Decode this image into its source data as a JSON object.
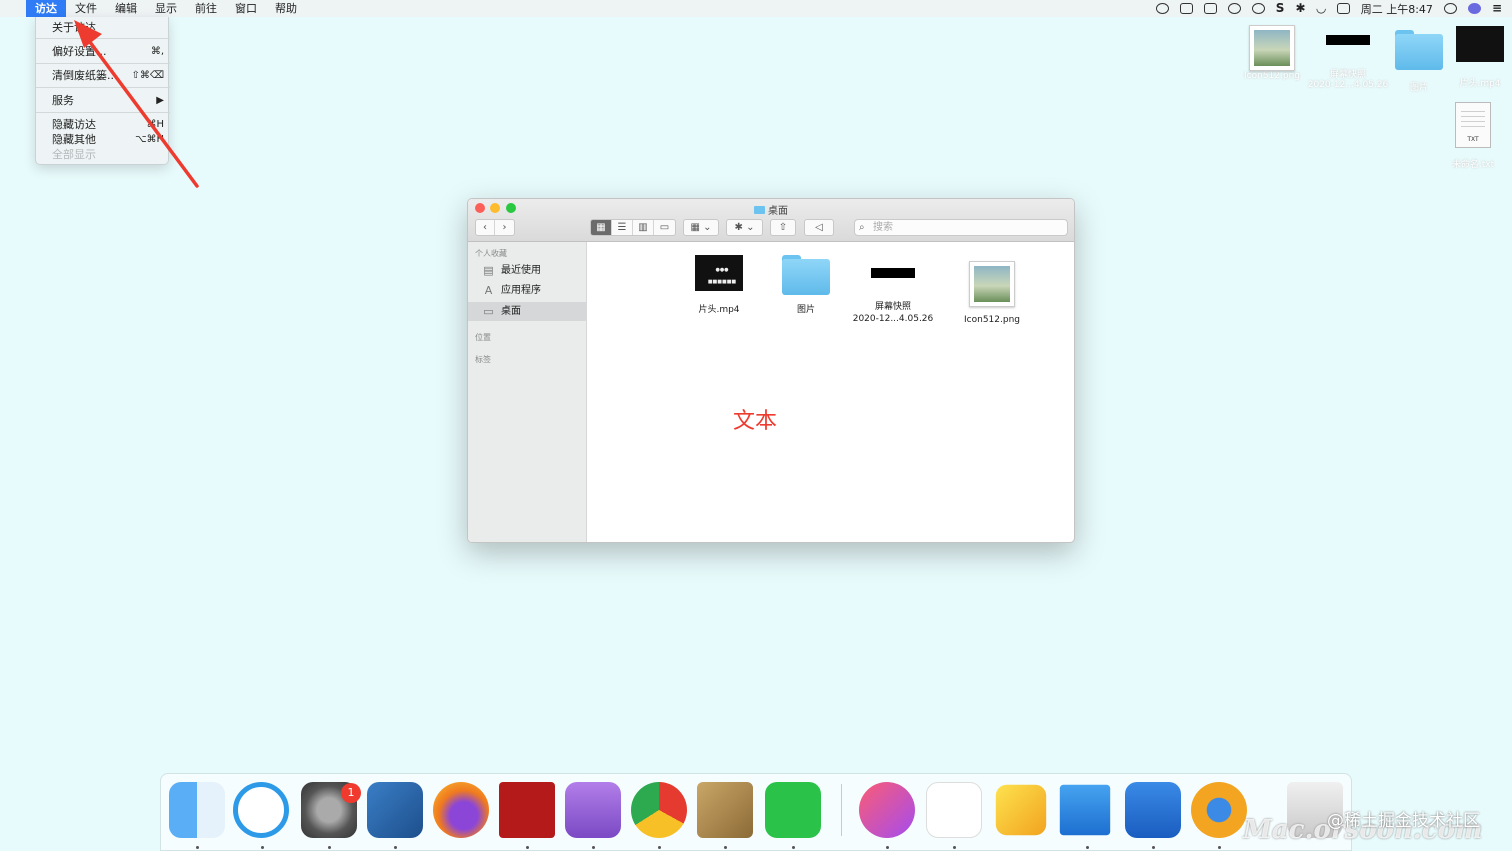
{
  "menubar": {
    "apple_icon": "apple-icon",
    "items": [
      "访达",
      "文件",
      "编辑",
      "显示",
      "前往",
      "窗口",
      "帮助"
    ],
    "active_index": 0,
    "clock": "周二 上午8:47"
  },
  "app_menu": {
    "about": "关于访达",
    "preferences": "偏好设置...",
    "preferences_shortcut": "⌘,",
    "empty_trash": "清倒废纸篓...",
    "empty_trash_shortcut": "⇧⌘⌫",
    "services": "服务",
    "services_arrow": "▶",
    "hide": "隐藏访达",
    "hide_shortcut": "⌘H",
    "hide_others": "隐藏其他",
    "hide_others_shortcut": "⌥⌘H",
    "show_all": "全部显示"
  },
  "desktop": {
    "icons": [
      {
        "label": "Icon512.png"
      },
      {
        "label": "屏幕快照",
        "label2": "2020-12...4.05.26"
      },
      {
        "label": "图片"
      },
      {
        "label": "片头.mp4"
      },
      {
        "label": "未命名.txt",
        "badge": "TXT"
      }
    ]
  },
  "finder": {
    "title": "桌面",
    "search_placeholder": "搜索",
    "sidebar": {
      "favorites_header": "个人收藏",
      "items": [
        "最近使用",
        "应用程序",
        "桌面"
      ],
      "selected_index": 2,
      "locations_header": "位置",
      "tags_header": "标签"
    },
    "files": [
      {
        "name": "片头.mp4",
        "thumb_text": "●●● ■■■■■■"
      },
      {
        "name": "图片"
      },
      {
        "name": "屏幕快照",
        "name2": "2020-12...4.05.26"
      },
      {
        "name": "Icon512.png"
      }
    ],
    "annotation": "文本"
  },
  "dock": {
    "apps": [
      "finder",
      "qq",
      "system-preferences",
      "xcode-instruments",
      "firefox",
      "filezilla",
      "downie",
      "chrome",
      "june-notebook",
      "wechat",
      "music",
      "baidu-netdisk",
      "sketch",
      "wps",
      "scrivener",
      "camtasia",
      "trash"
    ],
    "badge_count": "1"
  },
  "watermark": {
    "line1": "@稀土掘金技术社区",
    "line2": "Mac.orsoon.com"
  },
  "colors": {
    "accent": "#2f7cf6",
    "desktop": "#e8fbfc",
    "arrow": "#ee3b2f"
  }
}
